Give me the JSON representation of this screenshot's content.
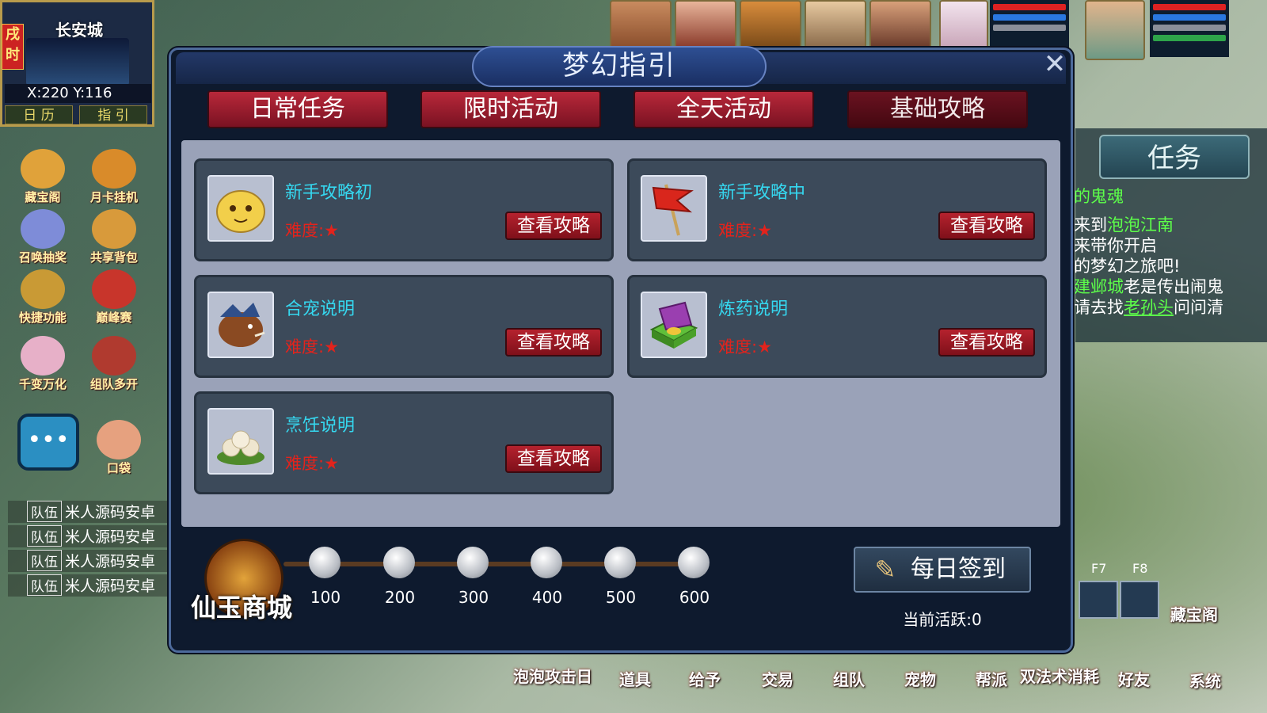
{
  "hud": {
    "time": "戌时",
    "city": "长安城",
    "coords": "X:220 Y:116",
    "calendar": "日 历",
    "guide": "指 引",
    "side_icons": [
      {
        "label": "藏宝阁",
        "color": "#e0a23a"
      },
      {
        "label": "月卡挂机",
        "color": "#d98b2a"
      },
      {
        "label": "召唤抽奖",
        "color": "#7e8cd8"
      },
      {
        "label": "共享背包",
        "color": "#d89a3b"
      },
      {
        "label": "快捷功能",
        "color": "#c99a35"
      },
      {
        "label": "巅峰赛",
        "color": "#c8352b"
      },
      {
        "label": "千变万化",
        "color": "#e7b0c8"
      },
      {
        "label": "组队多开",
        "color": "#b03a2f"
      },
      {
        "label": "口袋",
        "color": "#e6a17f"
      }
    ],
    "team_lines": [
      {
        "tag": "队伍",
        "text": "米人源码安卓"
      },
      {
        "tag": "队伍",
        "text": "米人源码安卓"
      },
      {
        "tag": "队伍",
        "text": "米人源码安卓"
      },
      {
        "tag": "队伍",
        "text": "米人源码安卓"
      }
    ]
  },
  "quest_panel": {
    "tab": "任务",
    "title": "的鬼魂",
    "lines": [
      [
        "来到",
        "泡泡江南"
      ],
      [
        "来带你开启",
        ""
      ],
      [
        "的梦幻之旅吧!",
        ""
      ],
      [
        "建邺城",
        "老是传出闹鬼"
      ],
      [
        "请去找",
        "老孙头",
        "问问清"
      ]
    ]
  },
  "fkeys": [
    "F7",
    "F8"
  ],
  "right_icon": "藏宝阁",
  "bottom_bar": [
    "泡泡攻击日",
    "道具",
    "给予",
    "交易",
    "组队",
    "宠物",
    "帮派",
    "双法术消耗",
    "好友",
    "系统"
  ],
  "dialog": {
    "title": "梦幻指引",
    "close": "✕",
    "tabs": [
      "日常任务",
      "限时活动",
      "全天活动",
      "基础攻略"
    ],
    "active_tab": 3,
    "cards": [
      {
        "title": "新手攻略初",
        "difficulty": "难度:★",
        "button": "查看攻略",
        "icon": "bun-icon"
      },
      {
        "title": "新手攻略中",
        "difficulty": "难度:★",
        "button": "查看攻略",
        "icon": "flag-icon"
      },
      {
        "title": "合宠说明",
        "difficulty": "难度:★",
        "button": "查看攻略",
        "icon": "boar-icon"
      },
      {
        "title": "炼药说明",
        "difficulty": "难度:★",
        "button": "查看攻略",
        "icon": "medicine-box-icon"
      },
      {
        "title": "烹饪说明",
        "difficulty": "难度:★",
        "button": "查看攻略",
        "icon": "steamed-buns-icon"
      }
    ],
    "shop_label": "仙玉商城",
    "milestones": [
      "100",
      "200",
      "300",
      "400",
      "500",
      "600"
    ],
    "signin": "每日签到",
    "activity": "当前活跃:0"
  }
}
